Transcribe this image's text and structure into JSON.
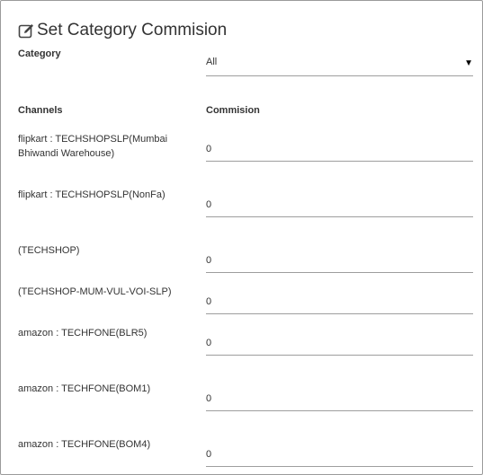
{
  "title": "Set Category Commision",
  "title_icon": "edit-icon",
  "category": {
    "label": "Category",
    "value": "All"
  },
  "headers": {
    "channels": "Channels",
    "commision": "Commision"
  },
  "rows": [
    {
      "channel": "flipkart : TECHSHOPSLP(Mumbai Bhiwandi Warehouse)",
      "commision": "0"
    },
    {
      "channel": "flipkart : TECHSHOPSLP(NonFa)",
      "commision": "0"
    },
    {
      "channel": "(TECHSHOP)",
      "commision": "0"
    },
    {
      "channel": "(TECHSHOP-MUM-VUL-VOI-SLP)",
      "commision": "0"
    },
    {
      "channel": "amazon : TECHFONE(BLR5)",
      "commision": "0"
    },
    {
      "channel": "amazon : TECHFONE(BOM1)",
      "commision": "0"
    },
    {
      "channel": "amazon : TECHFONE(BOM4)",
      "commision": "0"
    }
  ]
}
